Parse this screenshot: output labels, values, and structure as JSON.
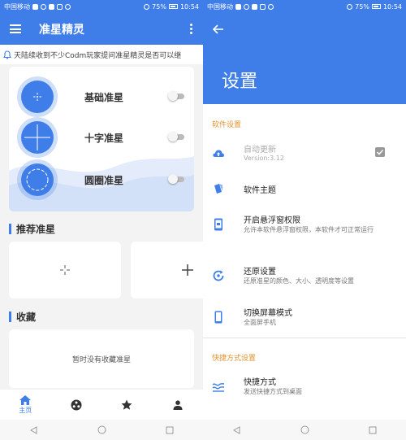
{
  "status_bar": {
    "carrier": "中国移动",
    "battery": "75%",
    "time": "10:54"
  },
  "main_screen": {
    "title": "准星精灵",
    "notice": "天陆续收到不少Codm玩家提问准星精灵是否可以继",
    "crosshairs": [
      {
        "label": "基础准星",
        "enabled": false
      },
      {
        "label": "十字准星",
        "enabled": false
      },
      {
        "label": "圆圈准星",
        "enabled": false
      }
    ],
    "recommended_title": "推荐准星",
    "favorites_title": "收藏",
    "favorites_empty": "暂时没有收藏准星",
    "bottom_nav": [
      {
        "label": "主页",
        "icon": "home-icon",
        "active": true
      },
      {
        "label": "",
        "icon": "crosshair-nav-icon",
        "active": false
      },
      {
        "label": "",
        "icon": "star-icon",
        "active": false
      },
      {
        "label": "",
        "icon": "person-icon",
        "active": false
      }
    ]
  },
  "settings_screen": {
    "title": "设置",
    "software_section": "软件设置",
    "shortcut_section": "快捷方式设置",
    "items": [
      {
        "title": "自动更新",
        "subtitle": "Version:3.12",
        "icon": "cloud-upload-icon",
        "checked": true
      },
      {
        "title": "软件主题",
        "subtitle": "",
        "icon": "theme-icon"
      },
      {
        "title": "开启悬浮窗权限",
        "subtitle": "允许本软件悬浮窗权限，本软件才可正常运行",
        "icon": "floating-window-icon"
      },
      {
        "title": "还原设置",
        "subtitle": "还原准星的颜色、大小、透明度等设置",
        "icon": "restore-icon"
      },
      {
        "title": "切换屏幕模式",
        "subtitle": "全面屏手机",
        "icon": "phone-screen-icon"
      },
      {
        "title": "快捷方式",
        "subtitle": "发送快捷方式到桌面",
        "icon": "shortcut-icon"
      }
    ]
  },
  "colors": {
    "accent": "#3f7ee8",
    "section_title": "#e09430"
  }
}
